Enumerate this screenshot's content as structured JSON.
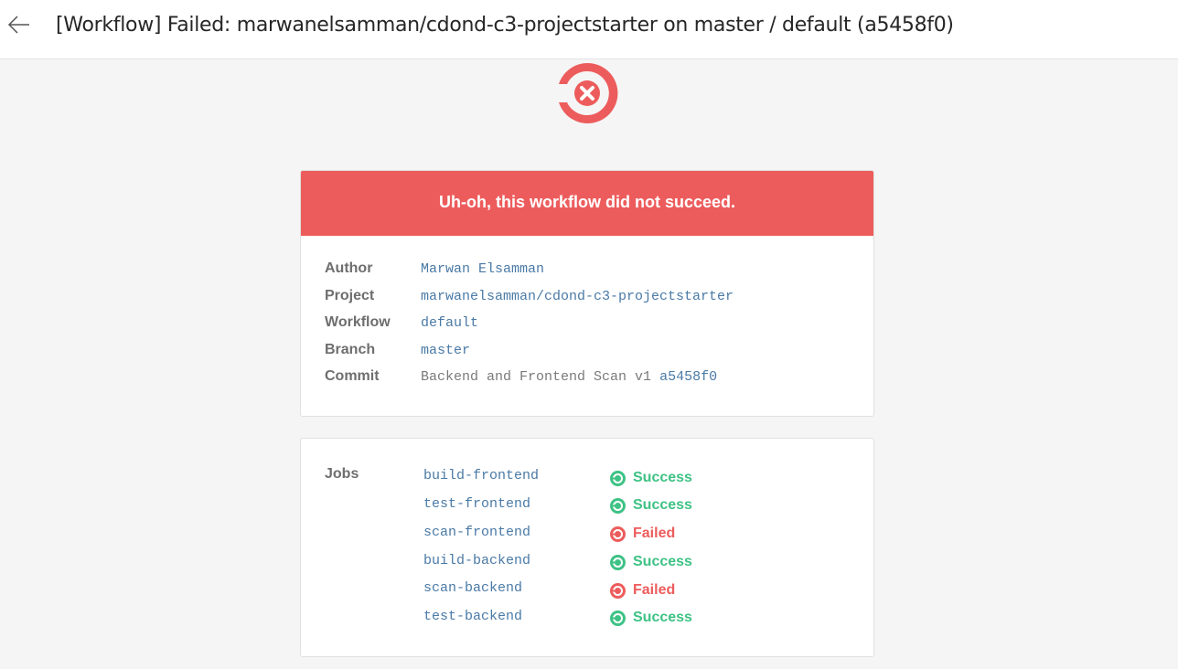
{
  "header": {
    "title": "[Workflow] Failed: marwanelsamman/cdond-c3-projectstarter on master / default (a5458f0)"
  },
  "banner": {
    "message": "Uh-oh, this workflow did not succeed."
  },
  "details": {
    "author_label": "Author",
    "author": "Marwan Elsamman",
    "project_label": "Project",
    "project": "marwanelsamman/cdond-c3-projectstarter",
    "workflow_label": "Workflow",
    "workflow": "default",
    "branch_label": "Branch",
    "branch": "master",
    "commit_label": "Commit",
    "commit_message": "Backend and Frontend Scan v1",
    "commit_hash": "a5458f0"
  },
  "jobs": {
    "label": "Jobs",
    "items": [
      {
        "name": "build-frontend",
        "status": "Success",
        "status_key": "success"
      },
      {
        "name": "test-frontend",
        "status": "Success",
        "status_key": "success"
      },
      {
        "name": "scan-frontend",
        "status": "Failed",
        "status_key": "failed"
      },
      {
        "name": "build-backend",
        "status": "Success",
        "status_key": "success"
      },
      {
        "name": "scan-backend",
        "status": "Failed",
        "status_key": "failed"
      },
      {
        "name": "test-backend",
        "status": "Success",
        "status_key": "success"
      }
    ]
  },
  "colors": {
    "failed": "#ed5c5c",
    "success": "#3ec285",
    "link": "#4a7aa6"
  },
  "icons": {
    "back": "arrow-left-icon",
    "logo": "circleci-failed-logo-icon",
    "success": "success-status-icon",
    "failed": "failed-status-icon"
  }
}
